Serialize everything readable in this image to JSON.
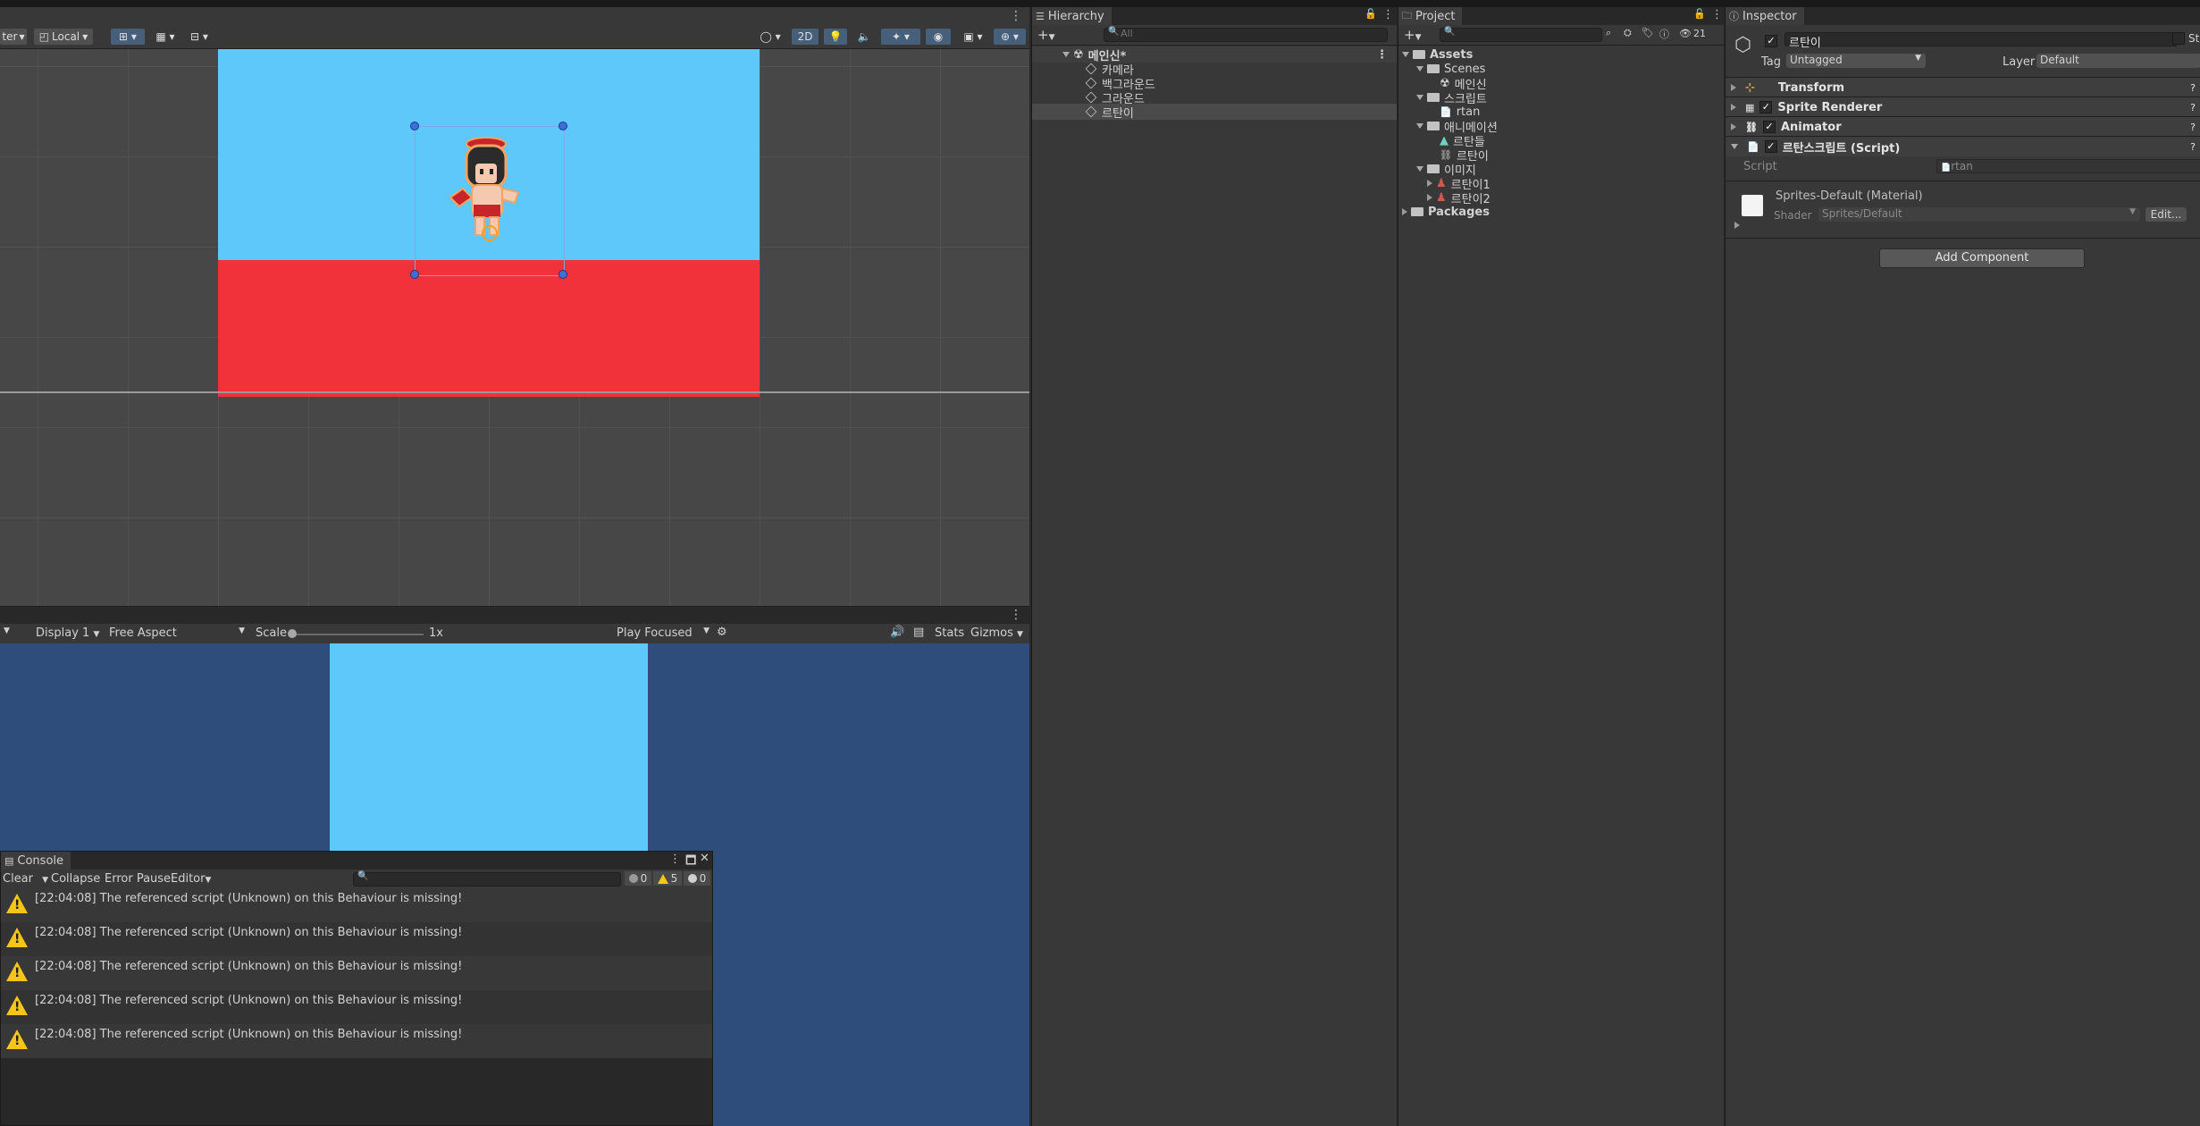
{
  "scene_toolbar": {
    "pivot_label": "ter",
    "space_label": "Local",
    "mode_2d": "2D"
  },
  "game_toolbar": {
    "display": "Display 1",
    "aspect": "Free Aspect",
    "scale_label": "Scale",
    "scale_value": "1x",
    "play_mode": "Play Focused",
    "stats": "Stats",
    "gizmos": "Gizmos"
  },
  "console": {
    "tab": "Console",
    "clear": "Clear",
    "collapse": "Collapse",
    "error_pause": "Error Pause",
    "editor": "Editor",
    "count_info": "0",
    "count_warn": "5",
    "count_error": "0",
    "messages": [
      "[22:04:08] The referenced script (Unknown) on this Behaviour is missing!",
      "[22:04:08] The referenced script (Unknown) on this Behaviour is missing!",
      "[22:04:08] The referenced script (Unknown) on this Behaviour is missing!",
      "[22:04:08] The referenced script (Unknown) on this Behaviour is missing!",
      "[22:04:08] The referenced script (Unknown) on this Behaviour is missing!"
    ]
  },
  "hierarchy": {
    "tab": "Hierarchy",
    "search_placeholder": "All",
    "scene": "메인신*",
    "items": [
      "카메라",
      "백그라운드",
      "그라운드",
      "르탄이"
    ]
  },
  "project": {
    "tab": "Project",
    "hidden_count": "21",
    "assets": "Assets",
    "scenes": "Scenes",
    "scene_file": "메인신",
    "scripts": "스크립트",
    "script_file": "rtan",
    "animations": "애니메이션",
    "anim_clip": "르탄들",
    "anim_controller": "르탄이",
    "images": "이미지",
    "image1": "르탄이1",
    "image2": "르탄이2",
    "packages": "Packages"
  },
  "inspector": {
    "tab": "Inspector",
    "object_name": "르탄이",
    "static_label": "Sta",
    "tag_label": "Tag",
    "tag_value": "Untagged",
    "layer_label": "Layer",
    "layer_value": "Default",
    "components": [
      "Transform",
      "Sprite Renderer",
      "Animator",
      "르탄스크립트 (Script)"
    ],
    "script_label": "Script",
    "script_value": "rtan",
    "material_name": "Sprites-Default (Material)",
    "shader_label": "Shader",
    "shader_value": "Sprites/Default",
    "edit_button": "Edit...",
    "add_component": "Add Component"
  },
  "colors": {
    "sky": "#5ec8fb",
    "ground": "#f2323a",
    "game_bg": "#2e4d7a",
    "accent": "#3a7bd5"
  }
}
